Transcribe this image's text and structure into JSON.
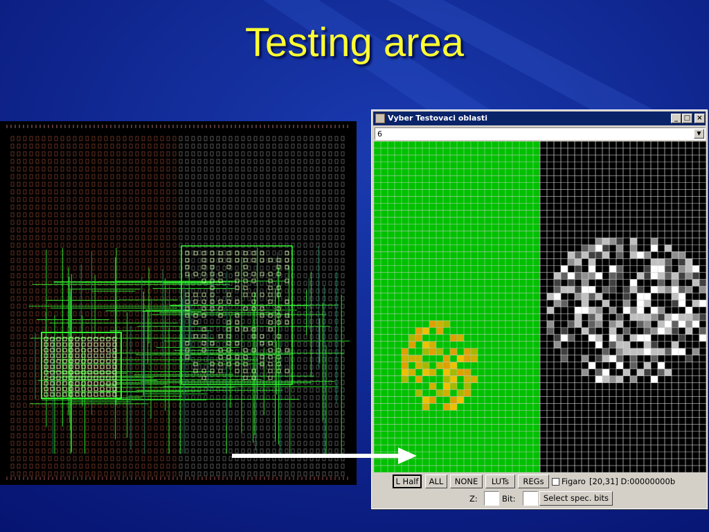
{
  "slide": {
    "title": "Testing area"
  },
  "window": {
    "title": "Vyber Testovaci oblasti",
    "controls": {
      "minimize": "_",
      "maximize": "□",
      "close": "×"
    },
    "selector": {
      "value": "6",
      "dropdown_icon": "triangle-down"
    }
  },
  "grid": {
    "columns": 48,
    "rows": 48,
    "left_fill": "#00c000",
    "highlight_colors": [
      "#f0c000",
      "#d0b000",
      "#a8b800",
      "#e0a000"
    ],
    "right_shades": [
      "#ffffff",
      "#c0c0c0",
      "#909090",
      "#606060",
      "#404040"
    ]
  },
  "toolbar": {
    "lhalf_label": "L Half",
    "all_label": "ALL",
    "none_label": "NONE",
    "luts_label": "LUTs",
    "regs_label": "REGs",
    "figaro_label": "Figaro",
    "coords_text": "[20,31] D:00000000b",
    "z_label": "Z:",
    "bit_label": "Bit:",
    "select_bits_label": "Select spec. bits"
  },
  "colors": {
    "title": "#ffff33",
    "background": "#0a1a8a",
    "routing": "#30ff30"
  }
}
